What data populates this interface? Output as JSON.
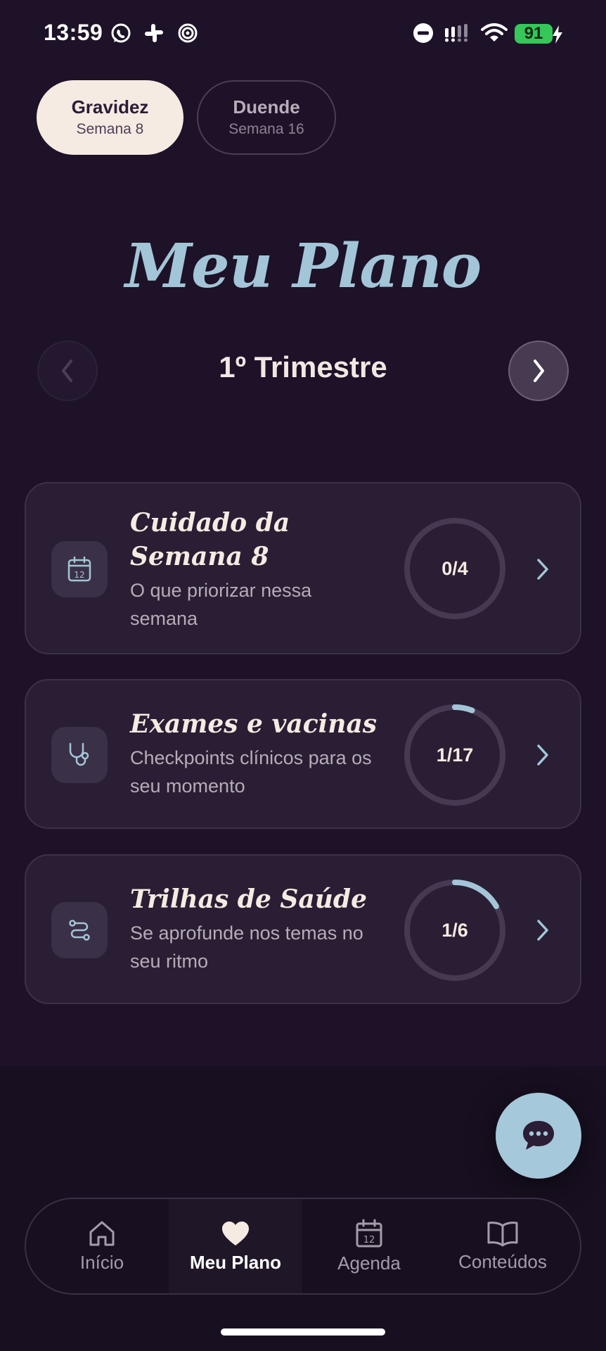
{
  "status_bar": {
    "time": "13:59",
    "battery": "91",
    "icons": [
      "whatsapp-icon",
      "slack-icon",
      "target-icon",
      "do-not-disturb-icon",
      "signal-icon",
      "wifi-icon",
      "battery-icon",
      "charging-icon"
    ]
  },
  "profiles": [
    {
      "name": "Gravidez",
      "week": "Semana 8",
      "active": true
    },
    {
      "name": "Duende",
      "week": "Semana 16",
      "active": false
    }
  ],
  "page": {
    "title": "Meu Plano"
  },
  "trimester": {
    "label": "1º Trimestre"
  },
  "cards": [
    {
      "title": "Cuidado da Semana 8",
      "description": "O que priorizar nessa semana",
      "progress_label": "0/4",
      "progress": 0,
      "icon": "calendar-icon"
    },
    {
      "title": "Exames e vacinas",
      "description": "Checkpoints clínicos para os seu momento",
      "progress_label": "1/17",
      "progress": 0.0588,
      "icon": "stethoscope-icon"
    },
    {
      "title": "Trilhas de Saúde",
      "description": "Se aprofunde nos temas no seu ritmo",
      "progress_label": "1/6",
      "progress": 0.1667,
      "icon": "route-icon"
    }
  ],
  "bottom_nav": {
    "items": [
      {
        "label": "Início",
        "icon": "home-icon",
        "active": false
      },
      {
        "label": "Meu Plano",
        "icon": "heart-icon",
        "active": true
      },
      {
        "label": "Agenda",
        "icon": "calendar-icon",
        "active": false
      },
      {
        "label": "Conteúdos",
        "icon": "book-icon",
        "active": false
      }
    ]
  },
  "colors": {
    "background": "#1d1228",
    "accent": "#a3c5d8",
    "card": "#291e33",
    "active_chip": "#f5ebe2",
    "ring_track": "#463a52"
  }
}
